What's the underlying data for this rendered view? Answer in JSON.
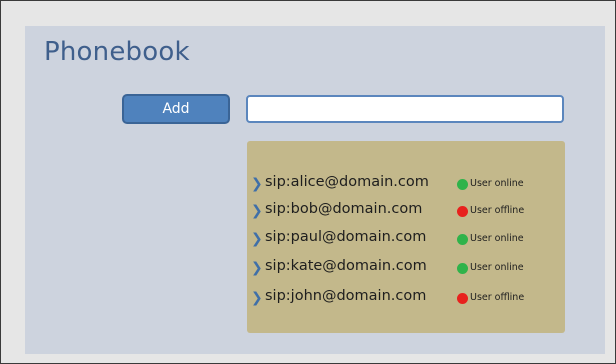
{
  "phonebook": {
    "title": "Phonebook",
    "add_label": "Add",
    "input_value": "",
    "input_placeholder": ""
  },
  "status_colors": {
    "online": "#2fb34a",
    "offline": "#e8211d"
  },
  "contacts": [
    {
      "address": "sip:alice@domain.com",
      "status": "User online",
      "state": "online"
    },
    {
      "address": "sip:bob@domain.com",
      "status": "User offline",
      "state": "offline"
    },
    {
      "address": "sip:paul@domain.com",
      "status": "User online",
      "state": "online"
    },
    {
      "address": "sip:kate@domain.com",
      "status": "User online",
      "state": "online"
    },
    {
      "address": "sip:john@domain.com",
      "status": "User offline",
      "state": "offline"
    }
  ]
}
